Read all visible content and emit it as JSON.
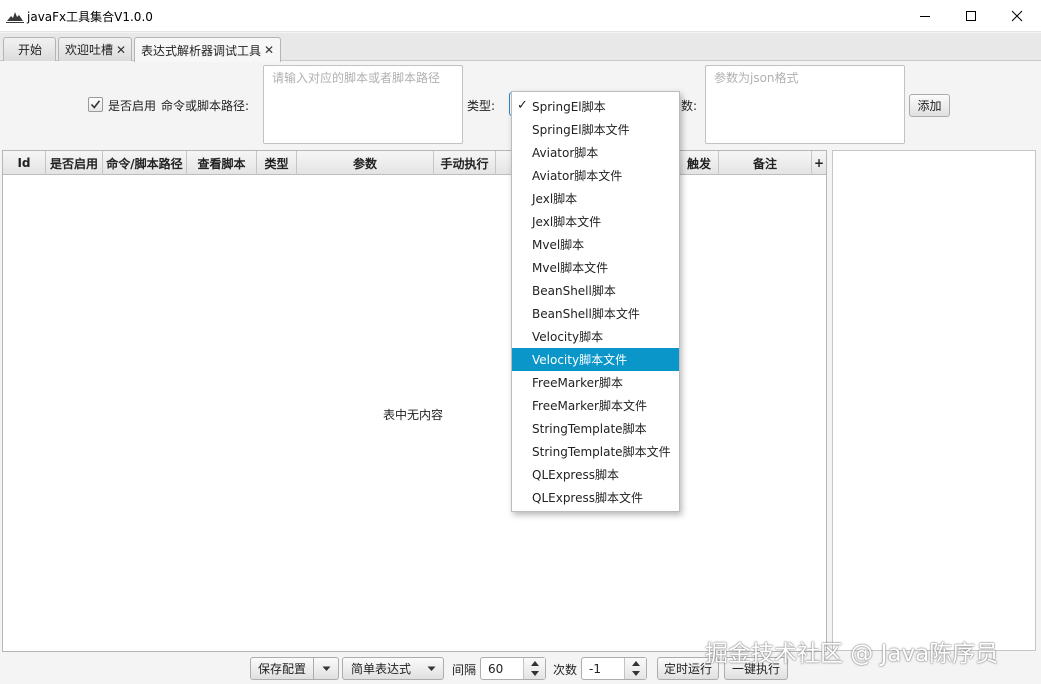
{
  "window": {
    "title": "javaFx工具集合V1.0.0"
  },
  "tabs": [
    {
      "label": "开始",
      "closable": false
    },
    {
      "label": "欢迎吐槽",
      "closable": true
    },
    {
      "label": "表达式解析器调试工具",
      "closable": true,
      "active": true
    }
  ],
  "form": {
    "enabled_label": "是否启用",
    "enabled_checked": true,
    "path_label": "命令或脚本路径:",
    "path_placeholder": "请输入对应的脚本或者脚本路径",
    "type_label": "类型:",
    "params_label": "数:",
    "params_placeholder": "参数为json格式",
    "add_button": "添加"
  },
  "table": {
    "columns": [
      "Id",
      "是否启用",
      "命令/脚本路径",
      "查看脚本",
      "类型",
      "参数",
      "手动执行",
      "",
      "",
      "触发",
      "备注",
      "+"
    ],
    "empty_message": "表中无内容"
  },
  "type_dropdown": {
    "selected": "SpringEl脚本",
    "highlighted": "Velocity脚本文件",
    "options": [
      "SpringEl脚本",
      "SpringEl脚本文件",
      "Aviator脚本",
      "Aviator脚本文件",
      "Jexl脚本",
      "Jexl脚本文件",
      "Mvel脚本",
      "Mvel脚本文件",
      "BeanShell脚本",
      "BeanShell脚本文件",
      "Velocity脚本",
      "Velocity脚本文件",
      "FreeMarker脚本",
      "FreeMarker脚本文件",
      "StringTemplate脚本",
      "StringTemplate脚本文件",
      "QLExpress脚本",
      "QLExpress脚本文件"
    ]
  },
  "toolbar": {
    "save_config": "保存配置",
    "expression_mode": "简单表达式",
    "interval_label": "间隔",
    "interval_value": "60",
    "count_label": "次数",
    "count_value": "-1",
    "timed_run": "定时运行",
    "run_all": "一键执行"
  },
  "watermark": "掘金技术社区 @ Java陈序员",
  "colors": {
    "accent": "#0a96c9",
    "focus_border": "#2b8ad4"
  }
}
